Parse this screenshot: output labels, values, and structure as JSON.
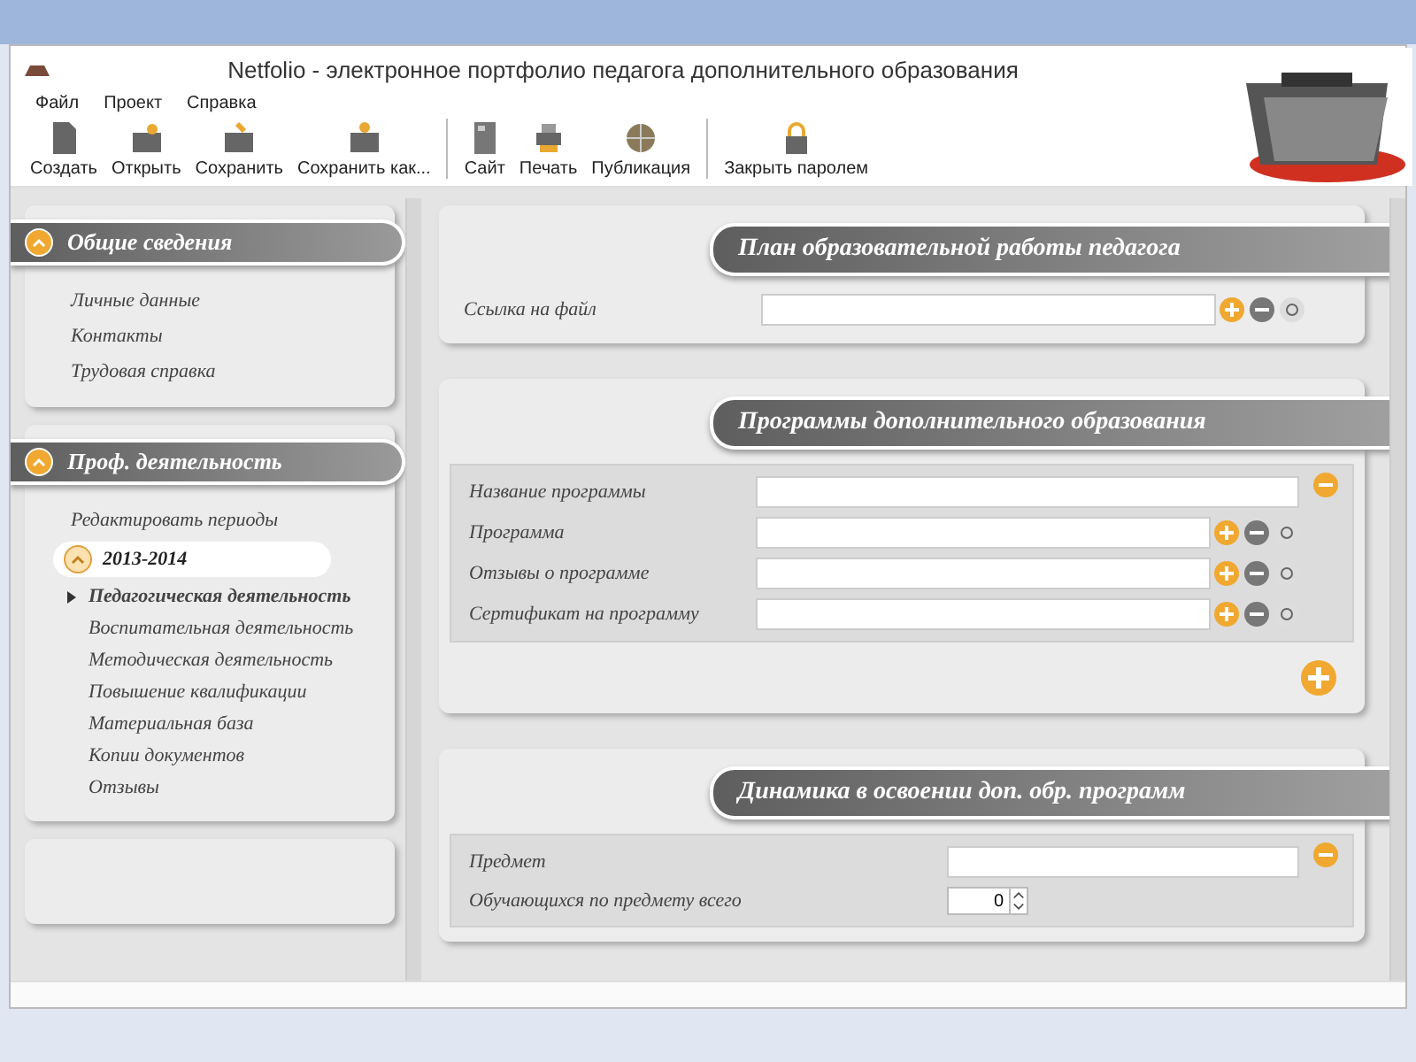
{
  "window": {
    "title": "Netfolio - электронное портфолио педагога дополнительного образования"
  },
  "menu": [
    "Файл",
    "Проект",
    "Справка"
  ],
  "toolbar": [
    {
      "label": "Создать",
      "kind": "new"
    },
    {
      "label": "Открыть",
      "kind": "open"
    },
    {
      "label": "Сохранить",
      "kind": "save"
    },
    {
      "label": "Сохранить как...",
      "kind": "saveas"
    },
    {
      "label": "Сайт",
      "kind": "site",
      "group_start": true
    },
    {
      "label": "Печать",
      "kind": "print"
    },
    {
      "label": "Публикация",
      "kind": "publish"
    },
    {
      "label": "Закрыть паролем",
      "kind": "lock",
      "group_start": true
    }
  ],
  "sidebar": {
    "sections": [
      {
        "title": "Общие сведения",
        "expanded": true,
        "items": [
          {
            "label": "Личные данные"
          },
          {
            "label": "Контакты"
          },
          {
            "label": "Трудовая справка"
          }
        ]
      },
      {
        "title": "Проф. деятельность",
        "expanded": true,
        "items": [
          {
            "label": "Редактировать периоды"
          }
        ],
        "periods": [
          {
            "label": "2013-2014",
            "expanded": true,
            "children": [
              {
                "label": "Педагогическая деятельность",
                "selected": true
              },
              {
                "label": "Воспитательная деятельность",
                "selected": false
              },
              {
                "label": "Методическая деятельность",
                "selected": false
              },
              {
                "label": "Повышение квалификации",
                "selected": false
              },
              {
                "label": "Материальная база",
                "selected": false
              },
              {
                "label": "Копии документов",
                "selected": false
              },
              {
                "label": "Отзывы",
                "selected": false
              }
            ]
          }
        ]
      }
    ]
  },
  "content": {
    "sections": [
      {
        "title": "План образовательной работы педагога",
        "groups": [
          {
            "fields": [
              {
                "label": "Ссылка на файл",
                "kind": "file"
              }
            ]
          }
        ]
      },
      {
        "title": "Программы дополнительного образования",
        "add_button": true,
        "groups": [
          {
            "boxed": true,
            "fields": [
              {
                "label": "Название программы",
                "kind": "text"
              },
              {
                "label": "Программа",
                "kind": "file"
              },
              {
                "label": "Отзывы о программе",
                "kind": "file"
              },
              {
                "label": "Сертификат на программу",
                "kind": "file"
              }
            ]
          }
        ]
      },
      {
        "title": "Динамика в освоении доп. обр. программ",
        "groups": [
          {
            "boxed": true,
            "narrow": true,
            "fields": [
              {
                "label": "Предмет",
                "kind": "text"
              },
              {
                "label": "Обучающихся по предмету всего",
                "kind": "number",
                "value": "0"
              }
            ]
          }
        ]
      }
    ]
  }
}
